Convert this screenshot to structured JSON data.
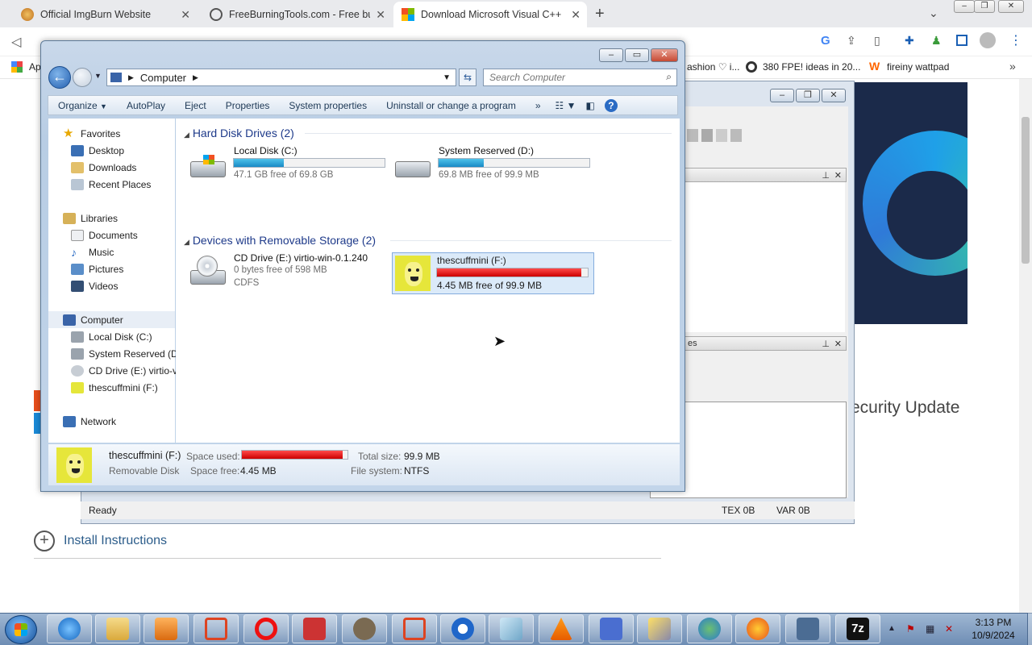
{
  "browser": {
    "tabs": [
      {
        "title": "Official ImgBurn Website",
        "icon": "imgburn-icon"
      },
      {
        "title": "FreeBurningTools.com - Free bur",
        "icon": "globe-icon"
      },
      {
        "title": "Download Microsoft Visual C++",
        "icon": "microsoft-icon"
      }
    ],
    "bookmarks": [
      "Ap",
      "ashion ♡ i...",
      "380 FPE! ideas in 20...",
      "fireiny wattpad"
    ]
  },
  "page": {
    "security_text": "ecurity Update",
    "install_label": "Install Instructions"
  },
  "bg_window": {
    "status_ready": "Ready",
    "status_tex": "TEX 0B",
    "status_var": "VAR 0B",
    "panel_label": "es"
  },
  "explorer": {
    "address_segments": [
      "Computer"
    ],
    "search_placeholder": "Search Computer",
    "commands": [
      "Organize",
      "AutoPlay",
      "Eject",
      "Properties",
      "System properties",
      "Uninstall or change a program"
    ],
    "nav": {
      "favorites": "Favorites",
      "favorites_items": [
        "Desktop",
        "Downloads",
        "Recent Places"
      ],
      "libraries": "Libraries",
      "libraries_items": [
        "Documents",
        "Music",
        "Pictures",
        "Videos"
      ],
      "computer": "Computer",
      "computer_items": [
        "Local Disk (C:)",
        "System Reserved (D:",
        "CD Drive (E:) virtio-v",
        "thescuffmini (F:)"
      ],
      "network": "Network"
    },
    "groups": {
      "hdd": "Hard Disk Drives (2)",
      "removable": "Devices with Removable Storage (2)"
    },
    "drives": [
      {
        "name": "Local Disk (C:)",
        "free": "47.1 GB free of 69.8 GB",
        "used_fraction": 0.33
      },
      {
        "name": "System Reserved (D:)",
        "free": "69.8 MB free of 99.9 MB",
        "used_fraction": 0.3
      },
      {
        "name": "CD Drive (E:) virtio-win-0.1.240",
        "free": "0 bytes free of 598 MB",
        "fs": "CDFS"
      },
      {
        "name": "thescuffmini (F:)",
        "free": "4.45 MB free of 99.9 MB",
        "used_fraction": 0.955
      }
    ],
    "details": {
      "name": "thescuffmini (F:)",
      "type": "Removable Disk",
      "space_used_label": "Space used:",
      "space_free_label": "Space free:",
      "space_free": "4.45 MB",
      "total_size_label": "Total size:",
      "total_size": "99.9 MB",
      "fs_label": "File system:",
      "fs": "NTFS",
      "used_fraction": 0.955
    }
  },
  "taskbar": {
    "time": "3:13 PM",
    "date": "10/9/2024"
  },
  "colors": {
    "accent_blue": "#1a8ac5",
    "full_red": "#cc0000",
    "group_header": "#1e3a8a"
  }
}
